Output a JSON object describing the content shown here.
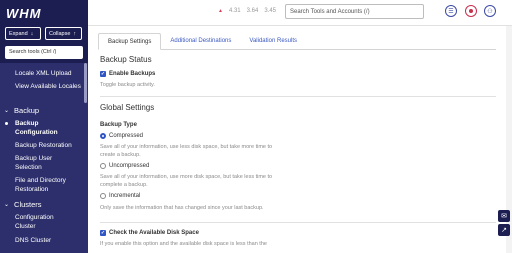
{
  "app": {
    "logo_text": "WHM"
  },
  "sidebar": {
    "expand_label": "Expand",
    "collapse_label": "Collapse",
    "search_placeholder": "Search tools (Ctrl /)",
    "items": [
      {
        "label": "Locale XML Upload",
        "type": "item"
      },
      {
        "label": "View Available Locales",
        "type": "item"
      },
      {
        "label": "Backup",
        "type": "head"
      },
      {
        "label": "Backup Configuration",
        "type": "item",
        "active": true
      },
      {
        "label": "Backup Restoration",
        "type": "item"
      },
      {
        "label": "Backup User Selection",
        "type": "item"
      },
      {
        "label": "File and Directory Restoration",
        "type": "item"
      },
      {
        "label": "Clusters",
        "type": "head"
      },
      {
        "label": "Configuration Cluster",
        "type": "item"
      },
      {
        "label": "DNS Cluster",
        "type": "item"
      }
    ]
  },
  "topbar": {
    "load_1": "4.31",
    "load_2": "3.64",
    "load_3": "3.45",
    "search_placeholder": "Search Tools and Accounts (/)",
    "icons": [
      "list-icon",
      "bell-icon",
      "user-icon"
    ]
  },
  "main": {
    "tabs": [
      {
        "label": "Backup Settings",
        "active": true
      },
      {
        "label": "Additional Destinations",
        "active": false
      },
      {
        "label": "Validation Results",
        "active": false
      }
    ],
    "backup_status": {
      "title": "Backup Status",
      "enable_label": "Enable Backups",
      "enable_checked": true,
      "help": "Toggle backup activity."
    },
    "global_settings": {
      "title": "Global Settings",
      "backup_type_label": "Backup Type",
      "options": [
        {
          "label": "Compressed",
          "selected": true,
          "help_1": "Save all of your information, use less disk space, but take more time to",
          "help_2": "create a backup."
        },
        {
          "label": "Uncompressed",
          "selected": false,
          "help_1": "Save all of your information, use more disk space, but take less time to",
          "help_2": "complete a backup."
        },
        {
          "label": "Incremental",
          "selected": false,
          "help_1": "Only save the information that has changed since your last backup.",
          "help_2": ""
        }
      ]
    },
    "check_disk": {
      "label": "Check the Available Disk Space",
      "checked": true,
      "help": "If you enable this option and the available disk space is less than the"
    }
  },
  "colors": {
    "sidebar_bg": "#1c1e52",
    "accent": "#2f55c5",
    "link": "#3c59c2"
  }
}
